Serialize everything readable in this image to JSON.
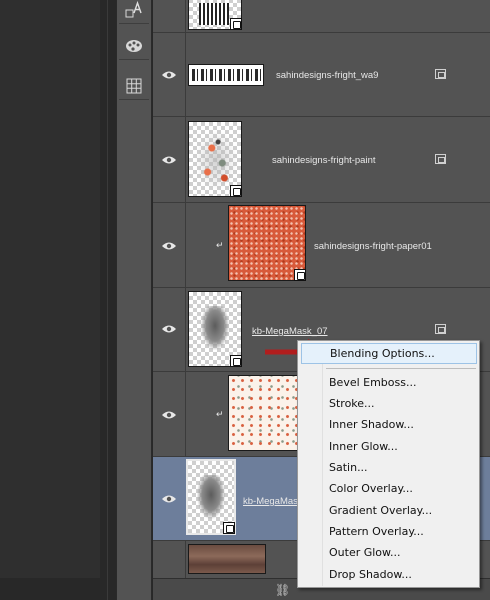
{
  "layers": [
    {
      "name": "",
      "type": "smart"
    },
    {
      "name": "sahindesigns-fright_wa9",
      "type": "wordart"
    },
    {
      "name": "sahindesigns-fright-paint",
      "type": "paint"
    },
    {
      "name": "sahindesigns-fright-paper01",
      "type": "paper-clipped"
    },
    {
      "name": "kb-MegaMask_07",
      "type": "mask"
    },
    {
      "name": "",
      "type": "floral-clipped"
    },
    {
      "name": "kb-MegaMas",
      "type": "mask-selected"
    },
    {
      "name": "",
      "type": "wood"
    }
  ],
  "context_menu": {
    "items": [
      "Blending Options...",
      "Bevel  Emboss...",
      "Stroke...",
      "Inner Shadow...",
      "Inner Glow...",
      "Satin...",
      "Color Overlay...",
      "Gradient Overlay...",
      "Pattern Overlay...",
      "Outer Glow...",
      "Drop Shadow..."
    ],
    "highlighted": "Blending Options..."
  },
  "colors": {
    "panel_bg": "#535353",
    "selected_row": "#6d7e9b",
    "annotation_arrow": "#b11d1d",
    "menu_bg": "#f0f0f0",
    "menu_highlight": "#e5f1fb"
  },
  "icons": {
    "tools": [
      "character-styles-icon",
      "swatches-palette-icon",
      "grid-layout-icon"
    ],
    "footer": "link-layers-icon",
    "visibility": "eye-icon"
  }
}
